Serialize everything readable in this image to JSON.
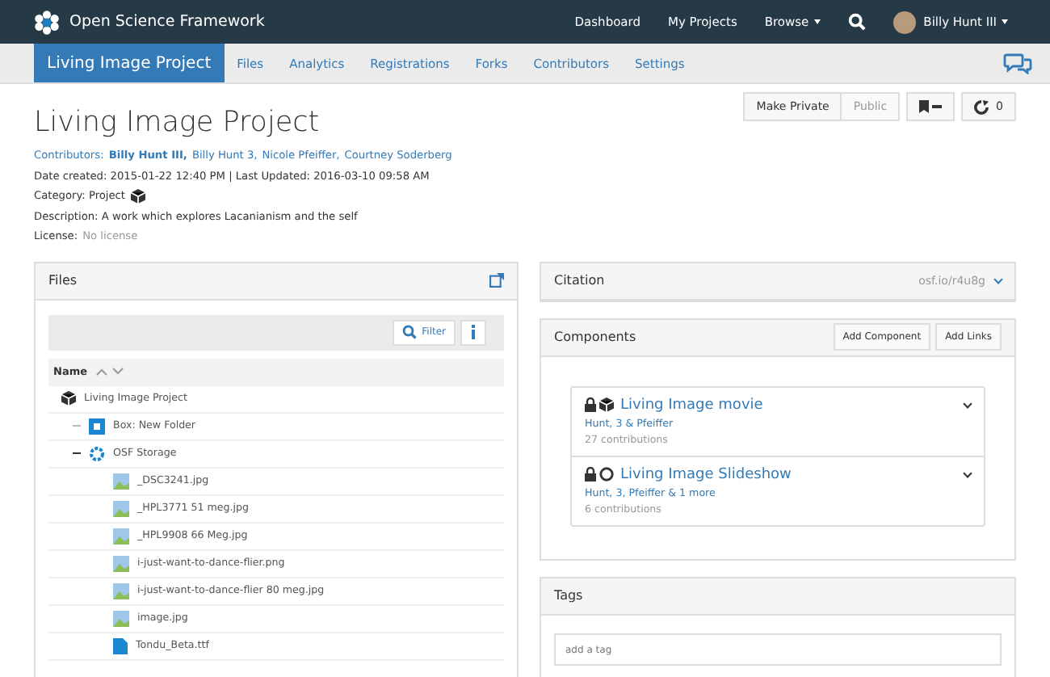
{
  "navbar": {
    "brand": "Open Science Framework",
    "links": [
      {
        "label": "Dashboard",
        "dropdown": false
      },
      {
        "label": "My Projects",
        "dropdown": false
      },
      {
        "label": "Browse",
        "dropdown": true
      }
    ],
    "user": "Billy Hunt III"
  },
  "project_nav": {
    "tabs": [
      {
        "label": "Living Image Project",
        "selected": true
      },
      {
        "label": "Files",
        "selected": false
      },
      {
        "label": "Analytics",
        "selected": false
      },
      {
        "label": "Registrations",
        "selected": false
      },
      {
        "label": "Forks",
        "selected": false
      },
      {
        "label": "Contributors",
        "selected": false
      },
      {
        "label": "Settings",
        "selected": false
      }
    ]
  },
  "header": {
    "title": "Living Image Project",
    "actions": [
      {
        "label": "Make Private",
        "selected": true
      },
      {
        "label": "Public",
        "selected": false
      }
    ],
    "forks": "0"
  },
  "meta": {
    "contributors_label": "Contributors:",
    "contributors": [
      {
        "name": "Billy Hunt III,",
        "current": true
      },
      {
        "name": "Billy Hunt 3,",
        "current": false
      },
      {
        "name": "Nicole Pfeiffer,",
        "current": false
      },
      {
        "name": "Courtney Soderberg",
        "current": false
      }
    ],
    "dates": "Date created: 2015-01-22 12:40 PM | Last Updated: 2016-03-10 09:58 AM",
    "category": "Category: Project",
    "description": "Description: A work which explores Lacanianism and the self",
    "license_label": "License:",
    "license": "No license"
  },
  "files": {
    "title": "Files",
    "filter": "Filter",
    "column": "Name",
    "tree": [
      {
        "name": "Living Image Project",
        "kind": "project",
        "children": [
          {
            "name": "Box: New Folder",
            "kind": "box",
            "expanded": false
          },
          {
            "name": "OSF Storage",
            "kind": "storage",
            "expanded": true,
            "children": [
              {
                "name": "_DSC3241.jpg",
                "kind": "image"
              },
              {
                "name": "_HPL3771 51 meg.jpg",
                "kind": "image"
              },
              {
                "name": "_HPL9908 66 Meg.jpg",
                "kind": "image"
              },
              {
                "name": "i-just-want-to-dance-flier.png",
                "kind": "image"
              },
              {
                "name": "i-just-want-to-dance-flier 80 meg.jpg",
                "kind": "image"
              },
              {
                "name": "image.jpg",
                "kind": "image"
              },
              {
                "name": "Tondu_Beta.ttf",
                "kind": "doc"
              }
            ]
          }
        ]
      }
    ]
  },
  "citation": {
    "title": "Citation",
    "link": "osf.io/r4u8g"
  },
  "components": {
    "title": "Components",
    "buttons": [
      "Add Component",
      "Add Links"
    ],
    "items": [
      {
        "title": "Living Image movie",
        "kind": "project",
        "authors": "Hunt, 3 & Pfeiffer",
        "count": "27 contributions"
      },
      {
        "title": "Living Image Slideshow",
        "kind": "other",
        "authors": "Hunt, 3, Pfeiffer & 1 more",
        "count": "6 contributions"
      }
    ]
  },
  "tags": {
    "title": "Tags",
    "placeholder": "add a tag"
  }
}
